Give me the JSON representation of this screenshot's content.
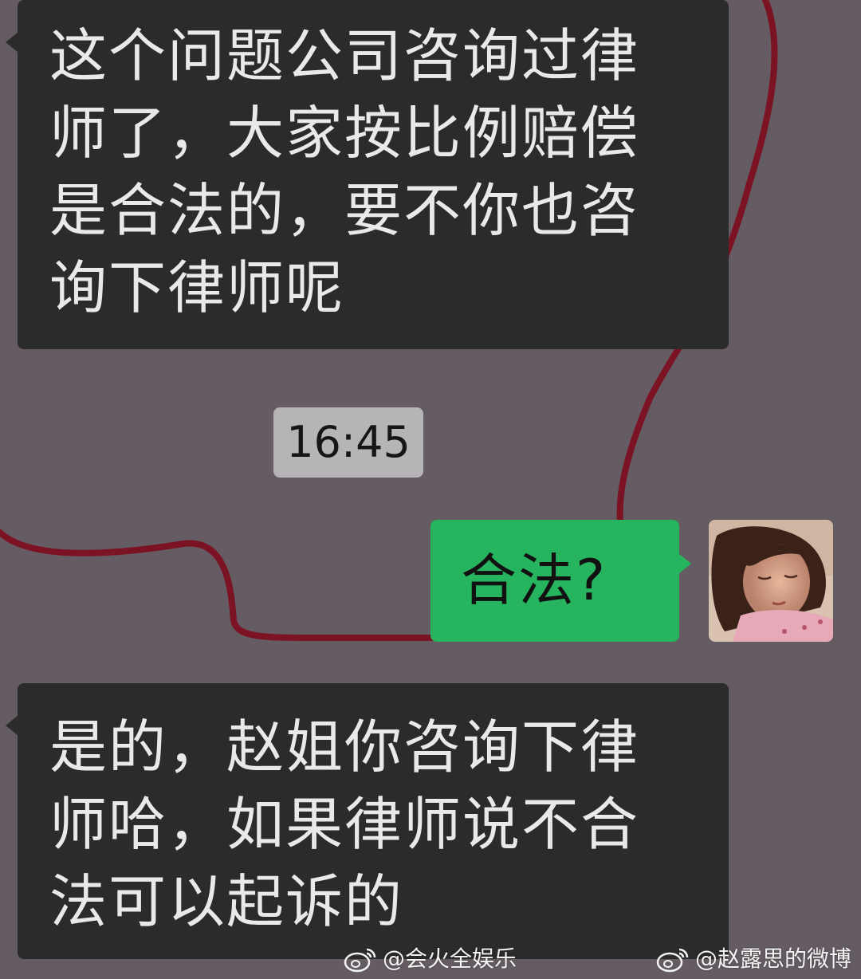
{
  "chat": {
    "messages": [
      {
        "direction": "incoming",
        "text": "这个问题公司咨询过律师了，大家按比例赔偿是合法的，要不你也咨询下律师呢"
      },
      {
        "direction": "outgoing",
        "text": "合法?"
      },
      {
        "direction": "incoming",
        "text": "是的，赵姐你咨询下律师哈，如果律师说不合法可以起诉的"
      }
    ],
    "timestamp": "16:45"
  },
  "watermarks": {
    "left": "@会火全娱乐",
    "right": "@赵露思的微博",
    "logo_icon": "weibo-logo-icon"
  },
  "colors": {
    "background": "#655b63",
    "incoming_bubble": "#2b2b2b",
    "outgoing_bubble": "#26b55e",
    "timestamp_bg": "#b7b4b7",
    "drawn_line": "#7c1325"
  }
}
